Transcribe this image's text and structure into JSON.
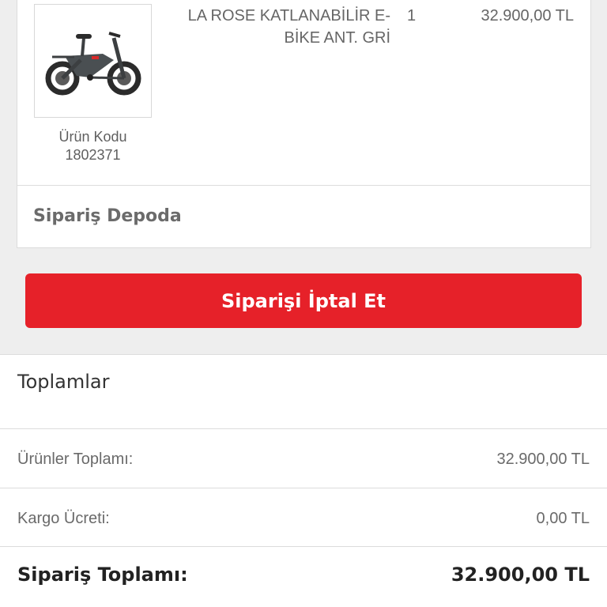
{
  "product": {
    "image_icon": "folding-e-bike",
    "code_label": "Ürün Kodu",
    "code_value": "1802371",
    "name": "LA ROSE KATLANABİLİR E-BİKE ANT. GRİ",
    "quantity": "1",
    "price": "32.900,00 TL",
    "status": "Sipariş Depoda"
  },
  "actions": {
    "cancel_label": "Siparişi İptal Et"
  },
  "totals": {
    "title": "Toplamlar",
    "products_total_label": "Ürünler Toplamı:",
    "products_total_value": "32.900,00 TL",
    "shipping_label": "Kargo Ücreti:",
    "shipping_value": "0,00 TL",
    "order_total_label": "Sipariş Toplamı:",
    "order_total_value": "32.900,00 TL"
  },
  "colors": {
    "accent": "#e62129",
    "background": "#eeeeee",
    "card": "#ffffff"
  }
}
